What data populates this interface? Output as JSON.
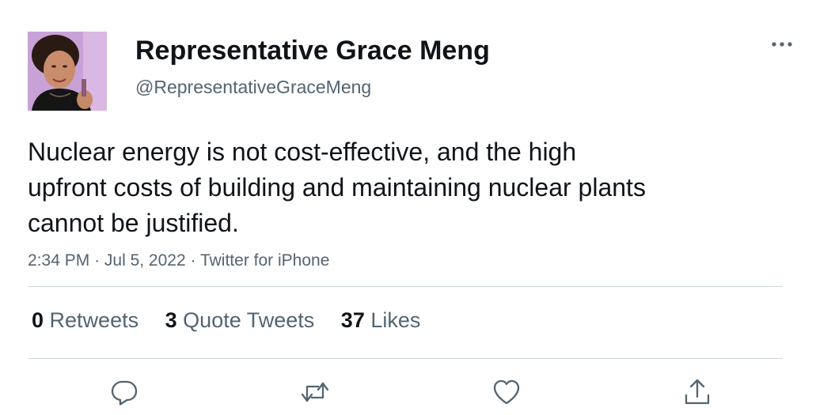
{
  "author": {
    "display_name": "Representative Grace Meng",
    "handle": "@RepresentativeGraceMeng"
  },
  "tweet": {
    "text": "Nuclear energy is not cost-effective, and the high upfront costs of building and maintaining nuclear plants cannot be justified.",
    "time": "2:34 PM",
    "date": "Jul 5, 2022",
    "source": "Twitter for iPhone",
    "separator": "·"
  },
  "stats": {
    "retweets": {
      "count": "0",
      "label": "Retweets"
    },
    "quotes": {
      "count": "3",
      "label": "Quote Tweets"
    },
    "likes": {
      "count": "37",
      "label": "Likes"
    }
  },
  "icons": {
    "more": "more-horizontal-icon",
    "reply": "reply-icon",
    "retweet": "retweet-icon",
    "like": "heart-icon",
    "share": "share-icon"
  },
  "colors": {
    "primary_text": "#0f1419",
    "secondary_text": "#536471",
    "divider": "#cfd9de",
    "icon": "#536471"
  }
}
